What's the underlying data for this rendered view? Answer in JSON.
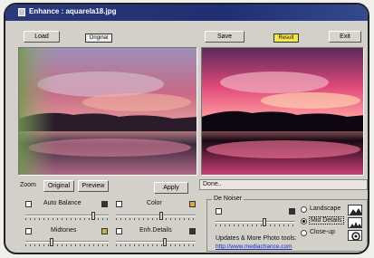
{
  "window": {
    "title": "Enhance : aquarela18.jpg"
  },
  "toolbar": {
    "load_label": "Load",
    "original_tag": "Original",
    "save_label": "Save",
    "result_tag": "Result",
    "exit_label": "Exit"
  },
  "view": {
    "zoom_label": "Zoom",
    "original_button": "Original",
    "preview_button": "Preview",
    "apply_button": "Apply"
  },
  "status": {
    "text": "Done.."
  },
  "adjustments": {
    "auto_balance": {
      "label": "Auto Balance",
      "level": 0.8
    },
    "color": {
      "label": "Color",
      "level": 0.55
    },
    "midtones": {
      "label": "Midtones",
      "level": 0.3
    },
    "enh_details": {
      "label": "Enh.Details",
      "level": 0.6
    }
  },
  "denoiser": {
    "title": "De Noiser",
    "level": 0.6,
    "options": [
      "Landscape",
      "Mid Details",
      "Close-up"
    ],
    "selected": "Mid Details"
  },
  "promo": {
    "text": "Updates & More Photo tools:",
    "url": "http://www.mediachance.com"
  },
  "colors": {
    "titlebar": "#1f2f73",
    "result_tag": "#f5e64a",
    "link": "#1a2bbd"
  }
}
